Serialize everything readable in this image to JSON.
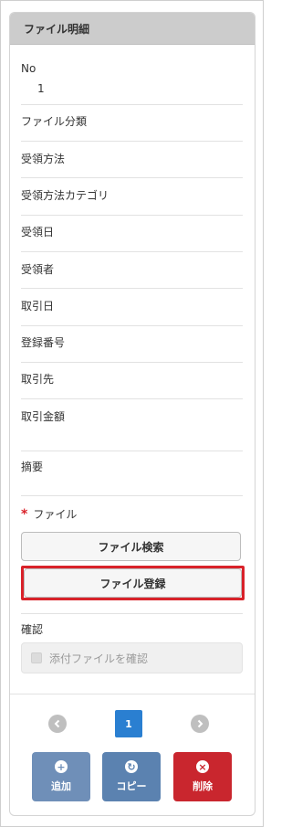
{
  "panel": {
    "title": "ファイル明細"
  },
  "fields": {
    "no_label": "No",
    "no_value": "1",
    "file_category": "ファイル分類",
    "receipt_method": "受領方法",
    "receipt_method_category": "受領方法カテゴリ",
    "receipt_date": "受領日",
    "receiver": "受領者",
    "transaction_date": "取引日",
    "registration_number": "登録番号",
    "counterparty": "取引先",
    "transaction_amount": "取引金額",
    "summary": "摘要"
  },
  "file_section": {
    "required_mark": "*",
    "label": "ファイル",
    "search_button": "ファイル検索",
    "register_button": "ファイル登録"
  },
  "confirm_section": {
    "label": "確認",
    "checkbox_label": "添付ファイルを確認"
  },
  "pager": {
    "current_page": "1",
    "prev_icon": "chevron-left-icon",
    "next_icon": "chevron-right-icon"
  },
  "actions": {
    "add_label": "追加",
    "copy_label": "コピー",
    "delete_label": "削除"
  },
  "colors": {
    "header_bg": "#cccccc",
    "highlight_border": "#d9222a",
    "page_active": "#2a7fd1",
    "add_btn": "#6f8fb8",
    "copy_btn": "#5b82b0",
    "delete_btn": "#c9262e"
  }
}
